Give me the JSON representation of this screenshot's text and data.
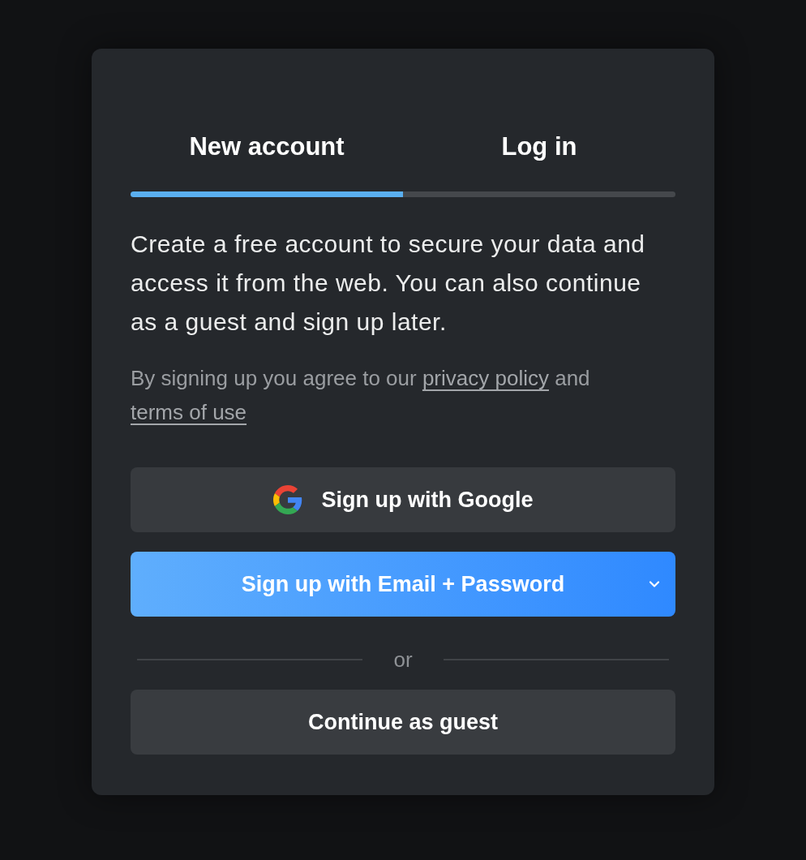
{
  "tabs": [
    {
      "label": "New account",
      "selected": true
    },
    {
      "label": "Log in",
      "selected": false
    }
  ],
  "intro": "Create a free account to secure your data and access it from the web. You can also continue as a guest and sign up later.",
  "agreement": [
    {
      "kind": "text",
      "text": "By signing up you agree to our "
    },
    {
      "kind": "link",
      "text": "privacy policy"
    },
    {
      "kind": "text",
      "text": " and "
    },
    {
      "kind": "link",
      "text": "terms of use"
    }
  ],
  "buttons": [
    {
      "kind": "google",
      "label": "Sign up with Google"
    },
    {
      "kind": "primary",
      "label": "Sign up with Email + Password"
    }
  ],
  "divider": "or",
  "guest_button": {
    "label": "Continue as guest"
  }
}
